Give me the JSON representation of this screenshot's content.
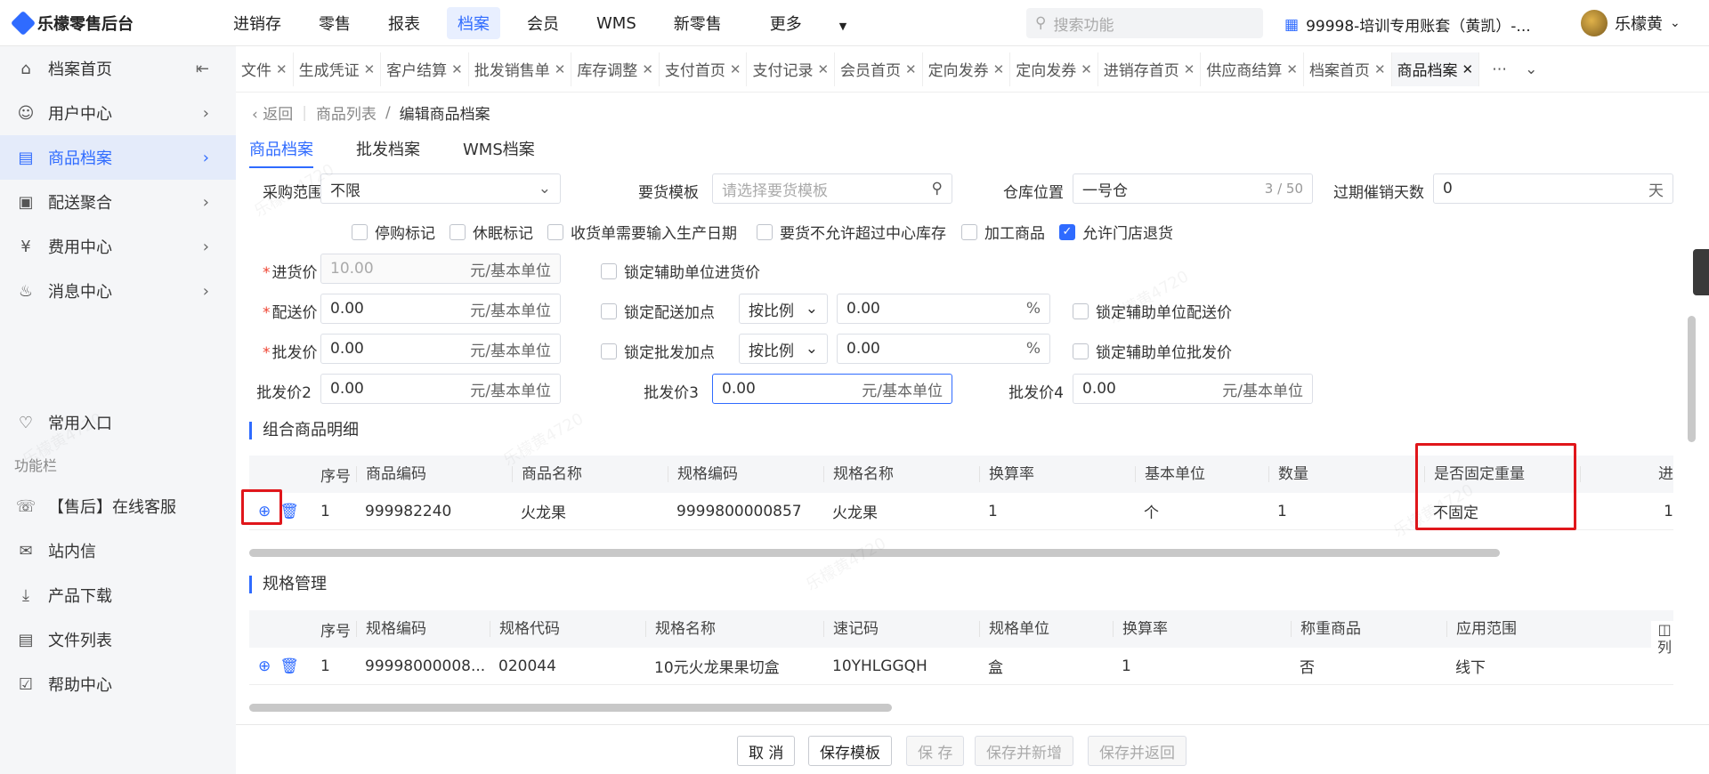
{
  "app": {
    "name": "乐檬零售后台"
  },
  "nav": [
    "进销存",
    "零售",
    "报表",
    "档案",
    "会员",
    "WMS",
    "新零售",
    "更多"
  ],
  "nav_active_index": 3,
  "search_placeholder": "搜索功能",
  "account": "99998-培训专用账套（黄凯）-...",
  "user_name": "乐檬黄",
  "sidebar": {
    "items": [
      {
        "label": "档案首页",
        "icon": "home-icon"
      },
      {
        "label": "用户中心",
        "icon": "user-icon"
      },
      {
        "label": "商品档案",
        "icon": "product-icon"
      },
      {
        "label": "配送聚合",
        "icon": "delivery-icon"
      },
      {
        "label": "费用中心",
        "icon": "yen-icon"
      },
      {
        "label": "消息中心",
        "icon": "bell-icon"
      }
    ],
    "favorite": "常用入口",
    "group_title": "功能栏",
    "tools": [
      "【售后】在线客服",
      "站内信",
      "产品下载",
      "文件列表",
      "帮助中心"
    ]
  },
  "tabs": [
    "文件",
    "生成凭证",
    "客户结算",
    "批发销售单",
    "库存调整",
    "支付首页",
    "支付记录",
    "会员首页",
    "定向发券",
    "定向发券",
    "进销存首页",
    "供应商结算",
    "档案首页",
    "商品档案"
  ],
  "breadcrumb": {
    "back": "返回",
    "parent": "商品列表",
    "current": "编辑商品档案"
  },
  "subtabs": [
    "商品档案",
    "批发档案",
    "WMS档案"
  ],
  "form": {
    "purchase_scope": {
      "label": "采购范围",
      "value": "不限"
    },
    "order_template": {
      "label": "要货模板",
      "placeholder": "请选择要货模板"
    },
    "warehouse": {
      "label": "仓库位置",
      "value": "一号仓",
      "count": "3 / 50"
    },
    "expire_days": {
      "label": "过期催销天数",
      "value": "0",
      "unit": "天"
    },
    "checks": [
      {
        "label": "停购标记",
        "checked": false
      },
      {
        "label": "休眠标记",
        "checked": false
      },
      {
        "label": "收货单需要输入生产日期",
        "checked": false
      },
      {
        "label": "要货不允许超过中心库存",
        "checked": false
      },
      {
        "label": "加工商品",
        "checked": false
      },
      {
        "label": "允许门店退货",
        "checked": true
      }
    ],
    "purchase_price": {
      "label": "进货价",
      "value": "10.00",
      "unit": "元/基本单位",
      "lock": "锁定辅助单位进货价"
    },
    "delivery_price": {
      "label": "配送价",
      "value": "0.00",
      "unit": "元/基本单位",
      "lock_markup": "锁定配送加点",
      "mode": "按比例",
      "pct": "0.00",
      "pct_unit": "%",
      "lock_aux": "锁定辅助单位配送价"
    },
    "wholesale_price": {
      "label": "批发价",
      "value": "0.00",
      "unit": "元/基本单位",
      "lock_markup": "锁定批发加点",
      "mode": "按比例",
      "pct": "0.00",
      "pct_unit": "%",
      "lock_aux": "锁定辅助单位批发价"
    },
    "wholesale2": {
      "label": "批发价2",
      "value": "0.00",
      "unit": "元/基本单位"
    },
    "wholesale3": {
      "label": "批发价3",
      "value": "0.00",
      "unit": "元/基本单位"
    },
    "wholesale4": {
      "label": "批发价4",
      "value": "0.00",
      "unit": "元/基本单位"
    }
  },
  "combo": {
    "title": "组合商品明细",
    "headers": [
      "序号",
      "商品编码",
      "商品名称",
      "规格编码",
      "规格名称",
      "换算率",
      "基本单位",
      "数量",
      "是否固定重量",
      "进"
    ],
    "rows": [
      [
        "1",
        "999982240",
        "火龙果",
        "9999800000857",
        "火龙果",
        "1",
        "个",
        "1",
        "不固定",
        "1"
      ]
    ]
  },
  "spec": {
    "title": "规格管理",
    "headers": [
      "序号",
      "规格编码",
      "规格代码",
      "规格名称",
      "速记码",
      "规格单位",
      "换算率",
      "称重商品",
      "应用范围"
    ],
    "rows": [
      [
        "1",
        "99998000008...",
        "020044",
        "10元火龙果果切盒",
        "10YHLGGQH",
        "盒",
        "1",
        "否",
        "线下"
      ]
    ],
    "col_toggle": "列"
  },
  "actions": {
    "cancel": "取 消",
    "save_template": "保存模板",
    "save": "保 存",
    "save_new": "保存并新增",
    "save_return": "保存并返回"
  },
  "watermark": "乐檬黄4720"
}
